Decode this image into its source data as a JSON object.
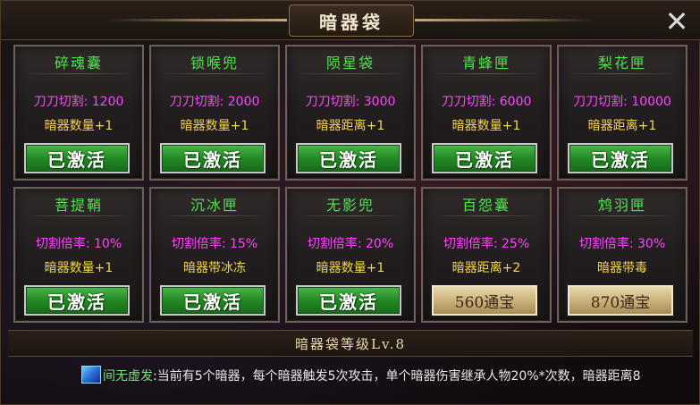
{
  "window": {
    "title": "暗器袋",
    "close_icon": "close-icon"
  },
  "cards": [
    {
      "name": "碎魂囊",
      "stat": "刀刀切割:  1200",
      "effect": "暗器数量+1",
      "button": "已激活",
      "state": "active"
    },
    {
      "name": "锁喉兜",
      "stat": "刀刀切割:  2000",
      "effect": "暗器数量+1",
      "button": "已激活",
      "state": "active"
    },
    {
      "name": "陨星袋",
      "stat": "刀刀切割:  3000",
      "effect": "暗器距离+1",
      "button": "已激活",
      "state": "active"
    },
    {
      "name": "青蜂匣",
      "stat": "刀刀切割:  6000",
      "effect": "暗器数量+1",
      "button": "已激活",
      "state": "active"
    },
    {
      "name": "梨花匣",
      "stat": "刀刀切割:  10000",
      "effect": "暗器距离+1",
      "button": "已激活",
      "state": "active"
    },
    {
      "name": "菩提鞘",
      "stat": "切割倍率:  10%",
      "effect": "暗器数量+1",
      "button": "已激活",
      "state": "active"
    },
    {
      "name": "沉冰匣",
      "stat": "切割倍率:  15%",
      "effect": "暗器带冰冻",
      "button": "已激活",
      "state": "active"
    },
    {
      "name": "无影兜",
      "stat": "切割倍率:  20%",
      "effect": "暗器数量+1",
      "button": "已激活",
      "state": "active"
    },
    {
      "name": "百怨囊",
      "stat": "切割倍率:  25%",
      "effect": "暗器距离+2",
      "button": "560通宝",
      "state": "price"
    },
    {
      "name": "鸩羽匣",
      "stat": "切割倍率:  30%",
      "effect": "暗器带毒",
      "button": "870通宝",
      "state": "price"
    }
  ],
  "level": {
    "label": "暗器袋等级Lv.8"
  },
  "description": {
    "skill_name": "间无虚发",
    "text": ":当前有5个暗器，每个暗器触发5次攻击，单个暗器伤害继承人物20%*次数，暗器距离8",
    "icon": "skill-icon"
  },
  "colors": {
    "name_green": "#4fe34f",
    "stat_magenta": "#ff45ff",
    "effect_yellow": "#f4d64a",
    "active_green": "#238a23",
    "price_gold": "#c8ad76"
  }
}
